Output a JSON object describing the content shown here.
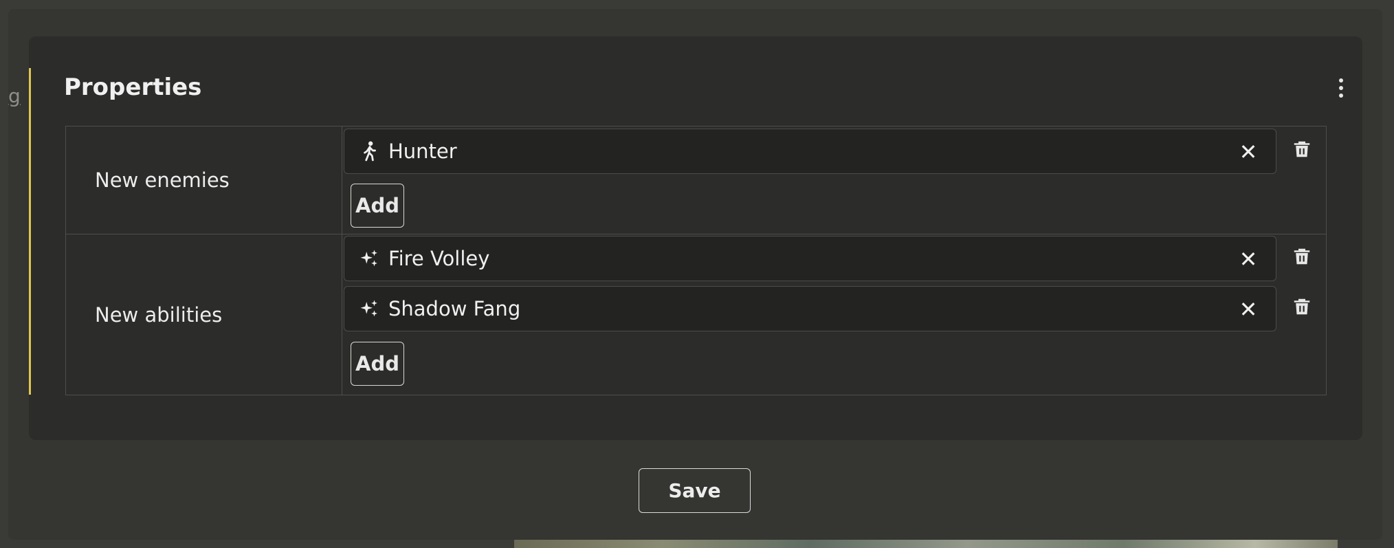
{
  "background_partial_text": "g",
  "panel": {
    "title": "Properties",
    "menu_icon": "kebab-menu-icon",
    "accent_color": "#e0c74f"
  },
  "rows": [
    {
      "label": "New enemies",
      "items": [
        {
          "icon": "walking-person-icon",
          "text": "Hunter"
        }
      ],
      "add_label": "Add"
    },
    {
      "label": "New abilities",
      "items": [
        {
          "icon": "sparkle-icon",
          "text": "Fire Volley"
        },
        {
          "icon": "sparkle-icon",
          "text": "Shadow Fang"
        }
      ],
      "add_label": "Add"
    }
  ],
  "remove_glyph": "✕",
  "save_label": "Save"
}
